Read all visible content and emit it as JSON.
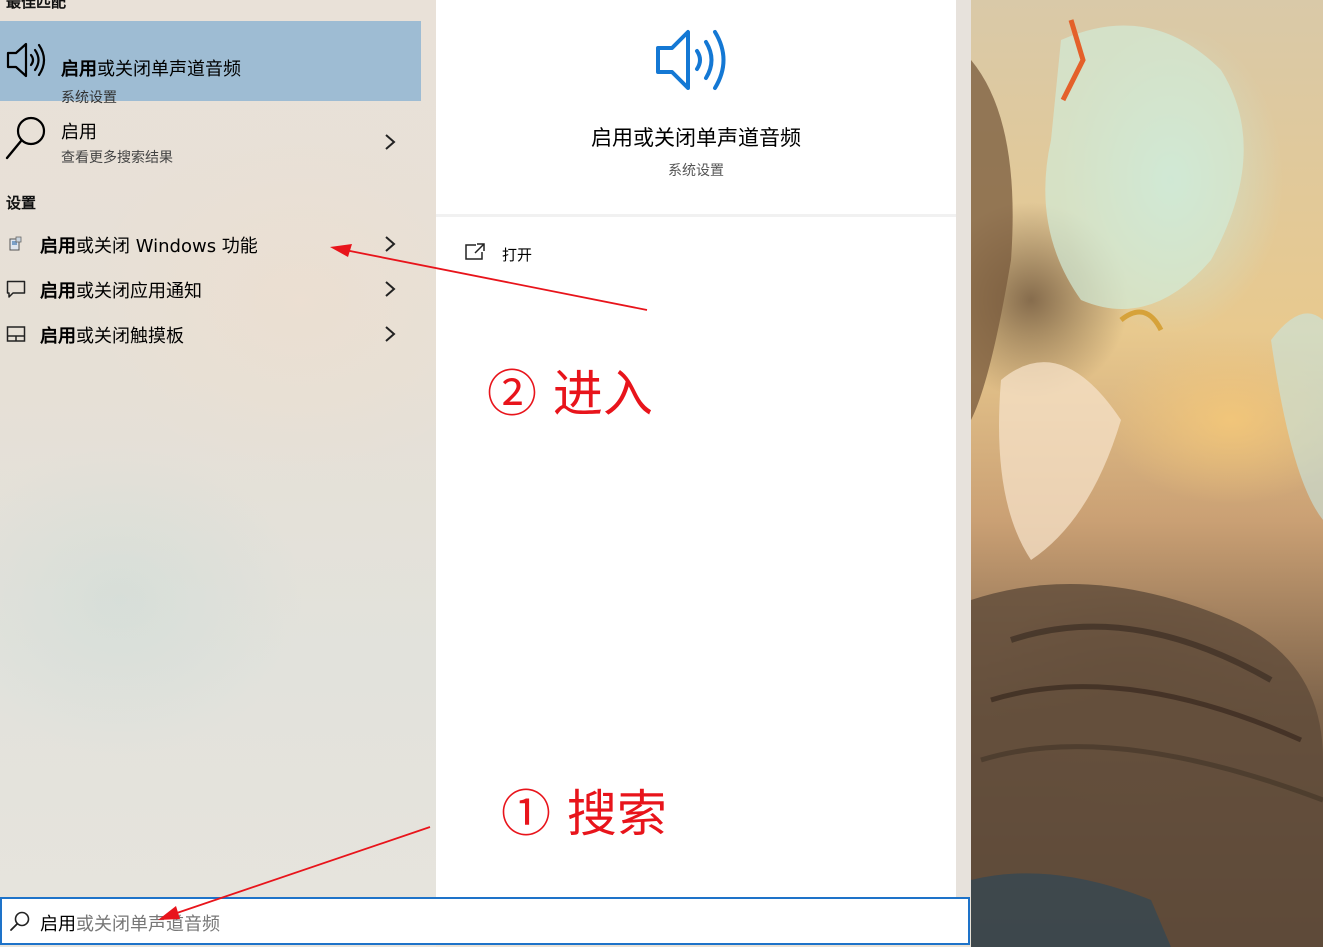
{
  "results": {
    "best_match_title": "最佳匹配",
    "best_match": {
      "title_bold": "启用",
      "title_rest": "或关闭单声道音频",
      "subtitle": "系统设置",
      "icon": "speaker-icon"
    },
    "web": {
      "title": "启用",
      "subtitle": "查看更多搜索结果",
      "icon": "search-icon"
    },
    "settings_title": "设置",
    "settings": [
      {
        "bold": "启用",
        "rest": "或关闭 Windows 功能",
        "icon": "windows-features-icon"
      },
      {
        "bold": "启用",
        "rest": "或关闭应用通知",
        "icon": "notification-icon"
      },
      {
        "bold": "启用",
        "rest": "或关闭触摸板",
        "icon": "touchpad-icon"
      }
    ]
  },
  "detail": {
    "title": "启用或关闭单声道音频",
    "subtitle": "系统设置",
    "open_label": "打开",
    "icon": "speaker-icon"
  },
  "search": {
    "typed": "启用",
    "suggestion": "或关闭单声道音频"
  },
  "annotations": {
    "enter": "② 进入",
    "search": "① 搜索",
    "color": "#e8141b"
  },
  "colors": {
    "selection": "#9ebcd3",
    "accent": "#1e73c9"
  }
}
